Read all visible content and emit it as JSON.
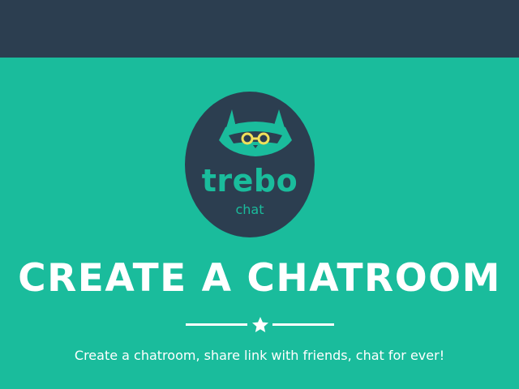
{
  "header": {},
  "logo": {
    "icon": "raccoon-with-glasses-icon",
    "brand_name": "trebo",
    "brand_sub": "chat"
  },
  "hero": {
    "headline": "CREATE A CHATROOM",
    "divider_icon": "star-icon",
    "tagline": "Create a chatroom, share link with friends, chat for ever!"
  },
  "colors": {
    "topbar": "#2c3e50",
    "background": "#1abc9c",
    "logo_circle": "#2c3e50",
    "brand_text": "#1abc9c",
    "glasses": "#f1e05a",
    "text": "#ffffff"
  }
}
